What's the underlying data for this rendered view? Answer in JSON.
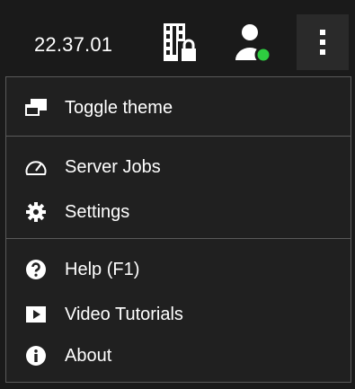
{
  "topbar": {
    "clock": "22.37.01",
    "film_icon": "film-lock-icon",
    "user_icon": "user-status-icon",
    "more_icon": "more-vertical-icon",
    "status_color": "#2ecc40"
  },
  "menu": {
    "items": [
      {
        "label": "Toggle theme",
        "icon": "toggle-theme-icon"
      },
      {
        "label": "Server Jobs",
        "icon": "gauge-icon"
      },
      {
        "label": "Settings",
        "icon": "gear-icon"
      },
      {
        "label": "Help (F1)",
        "icon": "help-icon"
      },
      {
        "label": "Video Tutorials",
        "icon": "play-icon"
      },
      {
        "label": "About",
        "icon": "info-icon"
      }
    ]
  }
}
